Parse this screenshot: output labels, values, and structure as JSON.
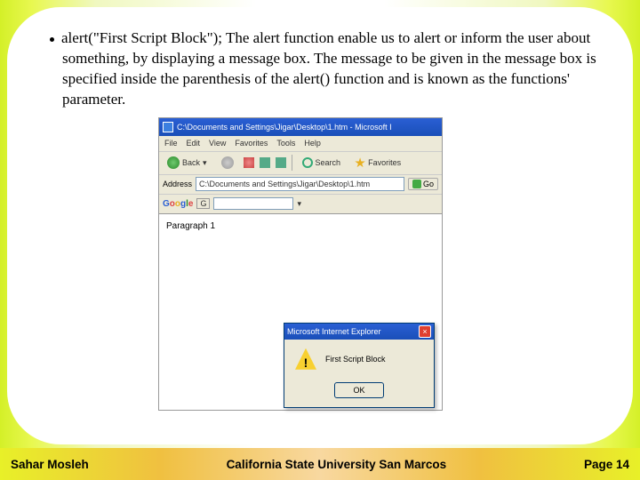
{
  "bullet": {
    "code": "alert(\"First Script Block\");",
    "desc": " The alert function enable us to alert or inform the user about something, by displaying a message box. The message to be given in the message box is specified inside the parenthesis of the alert() function and is known as the functions' parameter."
  },
  "ie": {
    "title": "C:\\Documents and Settings\\Jigar\\Desktop\\1.htm - Microsoft I",
    "menu": {
      "file": "File",
      "edit": "Edit",
      "view": "View",
      "favorites": "Favorites",
      "tools": "Tools",
      "help": "Help"
    },
    "toolbar": {
      "back": "Back",
      "search": "Search",
      "favorites": "Favorites"
    },
    "addressbar": {
      "label": "Address",
      "value": "C:\\Documents and Settings\\Jigar\\Desktop\\1.htm",
      "go": "Go"
    },
    "googlebar": {
      "logo": "Google",
      "dropdown": "G"
    },
    "content": {
      "paragraph": "Paragraph 1"
    },
    "alert": {
      "title": "Microsoft Internet Explorer",
      "message": "First Script Block",
      "ok": "OK",
      "exclaim": "!"
    }
  },
  "footer": {
    "author": "Sahar Mosleh",
    "university": "California State University San Marcos",
    "page": "Page 14"
  }
}
